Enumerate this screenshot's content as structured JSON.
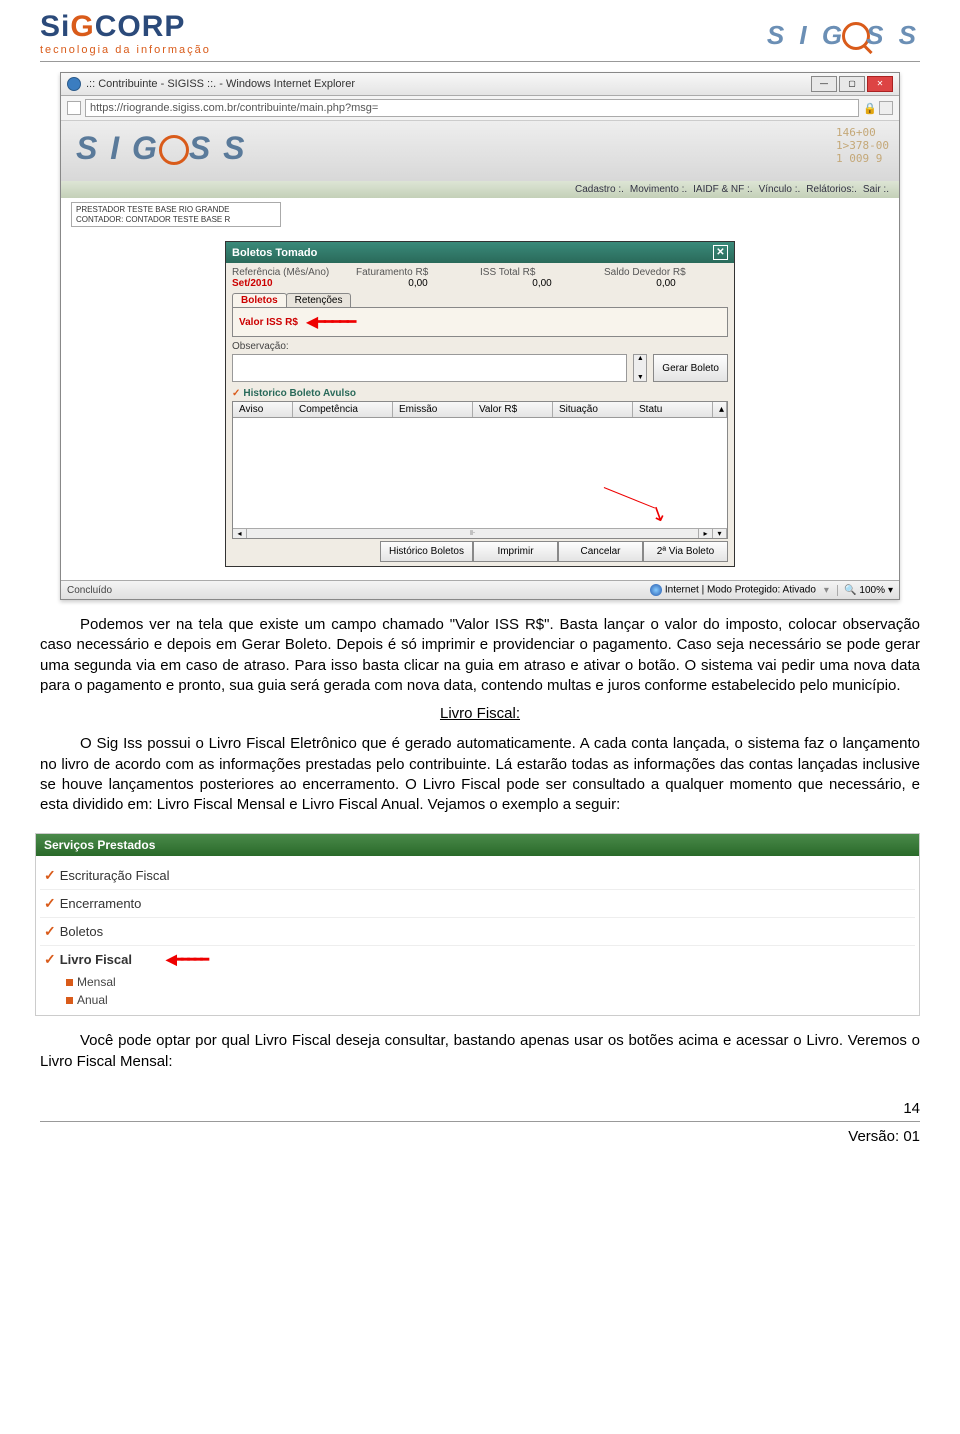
{
  "header": {
    "logo_left_text": "SiGCORP",
    "logo_tagline": "tecnologia da informação",
    "logo_right_text": "S I G",
    "logo_right_suffix": "S S"
  },
  "browser": {
    "title": ".:: Contribuinte - SIGISS ::. - Windows Internet Explorer",
    "url": "https://riogrande.sigiss.com.br/contribuinte/main.php?msg=",
    "header_deco": "146+00\n1>378-00\n1 009 9",
    "nav": [
      "Cadastro :.",
      "Movimento :.",
      "IAIDF & NF :.",
      "Vínculo :.",
      "Relátorios:.",
      "Sair :."
    ],
    "info_box_line1": "PRESTADOR TESTE BASE RIO GRANDE",
    "info_box_line2": "CONTADOR: CONTADOR TESTE BASE R",
    "modal": {
      "title": "Boletos Tomado",
      "headers": [
        "Referência (Mês/Ano)",
        "Faturamento R$",
        "ISS Total R$",
        "Saldo Devedor R$"
      ],
      "ref_value": "Set/2010",
      "fat_value": "0,00",
      "iss_value": "0,00",
      "saldo_value": "0,00",
      "tab_boletos": "Boletos",
      "tab_retencoes": "Retenções",
      "valor_label": "Valor ISS R$",
      "obs_label": "Observação:",
      "btn_gerar": "Gerar Boleto",
      "hist_title": "Historico Boleto Avulso",
      "hist_cols": [
        "Aviso",
        "Competência",
        "Emissão",
        "Valor R$",
        "Situação",
        "Statu"
      ],
      "btn_hist": "Histórico Boletos",
      "btn_imprimir": "Imprimir",
      "btn_cancelar": "Cancelar",
      "btn_2via": "2ª Via Boleto"
    },
    "status": {
      "left": "Concluído",
      "mid": "Internet | Modo Protegido: Ativado",
      "zoom": "100%"
    }
  },
  "text": {
    "p1": "Podemos ver na tela que existe um campo chamado \"Valor ISS R$\". Basta lançar o valor do imposto, colocar observação caso necessário e depois em Gerar Boleto. Depois é só imprimir e providenciar o pagamento. Caso seja necessário se pode gerar uma segunda via em caso de atraso. Para isso basta clicar na guia em atraso e ativar o botão. O sistema vai pedir uma nova data para o pagamento e pronto, sua guia será gerada com nova data, contendo multas e juros conforme estabelecido pelo município.",
    "section_title": "Livro Fiscal:",
    "p2": "O Sig Iss possui o Livro Fiscal Eletrônico que é gerado automaticamente. A cada conta lançada, o sistema faz o lançamento no livro de acordo com as informações prestadas pelo contribuinte. Lá estarão todas as informações das contas lançadas inclusive se houve lançamentos posteriores ao encerramento. O Livro Fiscal pode ser consultado a qualquer momento que necessário, e esta dividido em: Livro Fiscal Mensal e Livro Fiscal Anual. Vejamos o exemplo a seguir:",
    "p3": "Você pode optar por qual Livro Fiscal deseja consultar, bastando apenas usar os botões acima e acessar o Livro. Veremos o Livro Fiscal Mensal:"
  },
  "menu": {
    "header": "Serviços Prestados",
    "items": [
      "Escrituração Fiscal",
      "Encerramento",
      "Boletos",
      "Livro Fiscal"
    ],
    "sub": [
      "Mensal",
      "Anual"
    ]
  },
  "footer": {
    "page": "14",
    "version": "Versão: 01"
  }
}
